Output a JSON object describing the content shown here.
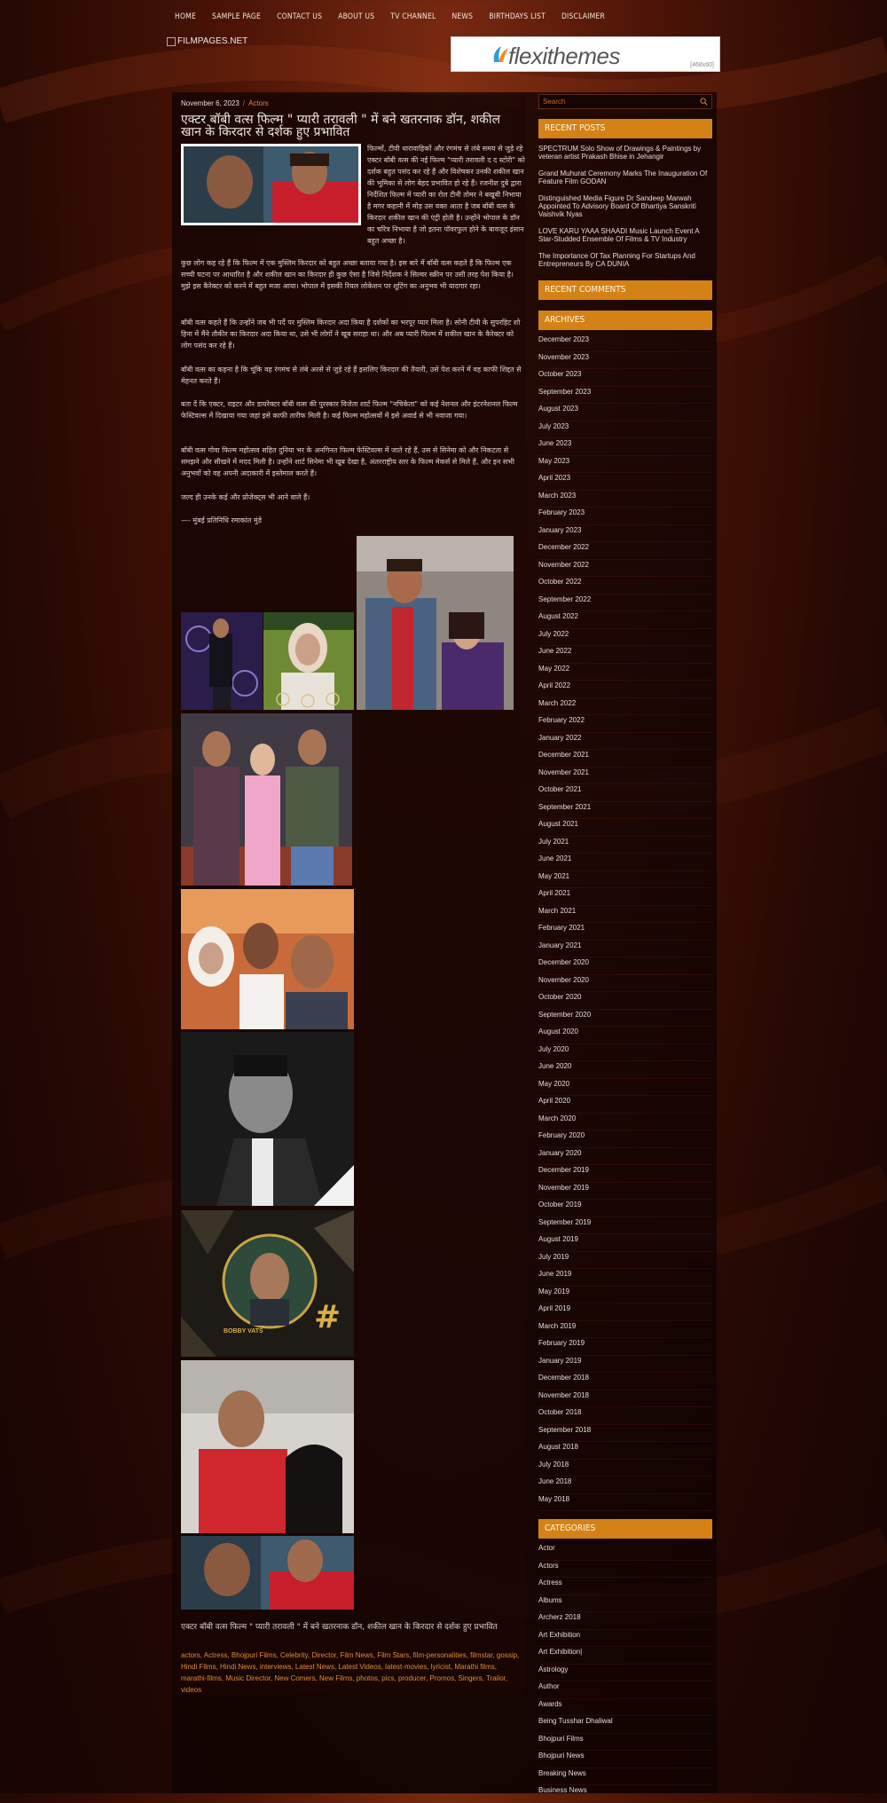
{
  "nav": [
    "HOME",
    "SAMPLE PAGE",
    "CONTACT US",
    "ABOUT US",
    "TV CHANNEL",
    "NEWS",
    "BIRTHDAYS LIST",
    "DISCLAIMER"
  ],
  "logo_text": "FILMPAGES.NET",
  "ad": {
    "brand": "flexithemes",
    "size": "[468x60]"
  },
  "post": {
    "date": "November 6, 2023",
    "category": "Actors",
    "title": "एक्टर बॉबी वत्स फिल्म \" प्यारी तरावली \" में बने खतरनाक डॉन, शकील खान के किरदार से दर्शक हुए प्रभावित",
    "para1": "फिल्मों, टीवी धारावाहिकों और रंगमंच से लंबे समय से जुड़े रहे एक्टर बॉबी वत्स की नई फिल्म \"प्यारी तरावली द द स्टोरी\" को दर्शक बहुत पसंद कर रहे हैं और विशेषकर उनकी शकील खान की भूमिका से लोग बेहद प्रभावित हो रहे हैं। रजनीश दुबे द्वारा निर्देशित फिल्म में प्यारी का रोल टीनी तोमर ने बखूबी निभाया है मगर कहानी में मोड़ उस वक्त आता है जब बॉबी वत्स के किरदार शकील खान की एंट्री होती है। उन्होंने भोपाल के डॉन का चरित्र निभाया है जो इतना पॉवरफुल होने के बावजूद इंसान बहुत अच्छा है।",
    "para2": "कुछ लोग कह रहे हैं कि फिल्म में एक मुस्लिम किरदार को बहुत अच्छा बताया गया है। इस बारे में बॉबी वत्स कहते हैं कि फिल्म एक सच्ची घटना पर आधारित है और शकील खान का किरदार ही कुछ ऐसा है जिसे निर्देशक ने सिल्वर स्क्रीन पर उसी तरह पेश किया है। मुझे इस कैरेक्टर को करने में बहुत मजा आया। भोपाल में इसकी रियल लोकेशन पर शूटिंग का अनुभव भी यादगार रहा।",
    "para3": "बॉबी वत्स कहते हैं कि उन्होंने जब भी पर्दे पर मुस्लिम किरदार अदा किया है दर्शकों का भरपूर प्यार मिला है। सोनी टीवी के सुपरहिट शो हिना में मैंने तौकीर का किरदार अदा किया था, उसे भी लोगों ने खूब सराहा था। और अब प्यारी फिल्म में शकील खान के कैरेक्टर को लोग पसंद कर रहे हैं।",
    "para4": "बॉबी वत्स का कहना है कि चूंकि वह रंगमंच से लंबे अरसे से जुड़े रहे हैं इसलिए किरदार की तैयारी, उसे पेश करने में वह काफी शिद्दत से मेहनत करते हैं।",
    "para5": "बता दें कि एक्टर, राइटर और डायरेक्टर बॉबी वत्स की पुरस्कार विजेता शार्ट फिल्म \"नचिकेता\" को कई नेशनल और इंटरनेशनल फिल्म फेस्टिवल्स में दिखाया गया जहां इसे काफी तारीफ मिली है। कई फिल्म महोत्सवों में इसे अवार्ड से भी नवाजा गया।",
    "para6": "बॉबी वत्स गोवा फिल्म महोत्सव सहित दुनिया भर के अनगिनत फिल्म फेस्टिवल्स में जाते रहे हैं, उस से सिनेमा को और निकटता से समझने और सीखने में मदद मिली है। उन्होंने शार्ट सिनेमा भी खूब देखा है, अंतरराष्ट्रीय स्तर के फिल्म मेकर्स से मिले हैं, और इन सभी अनुभवों को वह अपनी अदाकारी में इस्तेमाल करते हैं।",
    "para7": "जल्द ही उनके कई और प्रोजेक्ट्स भी आने वाले हैं।",
    "byline": "—- मुंबई प्रतिनिधि रमाकांत मुंडे",
    "gallery_caption": "BOBBY VATS",
    "footer_title": "एक्टर बॉबी वत्स फिल्म \" प्यारी तरावली \" में बने खतरनाक डॉन, शकील खान के किरदार से दर्शक हुए प्रभावित",
    "tags": "actors, Actress, Bhojpuri Films, Celebrity, Director, Film News, Film Stars, film-personalities, filmstar, gossip, Hindi Films, Hindi News, interviews, Latest News, Latest Videos, latest-movies, lyricist, Marathi films, marathi-films, Music Director, New Comers, New Films, photos, pics, producer, Promos, Singers, Trailor, videos"
  },
  "sidebar": {
    "search_placeholder": "Search",
    "recent_posts_title": "RECENT POSTS",
    "recent_posts": [
      "SPECTRUM Solo Show of Drawings & Paintings by veteran artist Prakash Bhise in Jehangir",
      "Grand Muhurat Ceremony Marks The Inauguration Of Feature Film GODAN",
      "Distinguished Media Figure Dr Sandeep Marwah Appointed To Advisory Board Of Bhartiya Sanskriti Vaishvik Nyas",
      "LOVE KARU YAAA SHAADI Music Launch Event A Star-Studded Ensemble Of Films & TV Industry",
      "The Importance Of Tax Planning For Startups And Entrepreneurs By CA DUNIA"
    ],
    "recent_comments_title": "RECENT COMMENTS",
    "archives_title": "ARCHIVES",
    "archives": [
      "December 2023",
      "November 2023",
      "October 2023",
      "September 2023",
      "August 2023",
      "July 2023",
      "June 2023",
      "May 2023",
      "April 2023",
      "March 2023",
      "February 2023",
      "January 2023",
      "December 2022",
      "November 2022",
      "October 2022",
      "September 2022",
      "August 2022",
      "July 2022",
      "June 2022",
      "May 2022",
      "April 2022",
      "March 2022",
      "February 2022",
      "January 2022",
      "December 2021",
      "November 2021",
      "October 2021",
      "September 2021",
      "August 2021",
      "July 2021",
      "June 2021",
      "May 2021",
      "April 2021",
      "March 2021",
      "February 2021",
      "January 2021",
      "December 2020",
      "November 2020",
      "October 2020",
      "September 2020",
      "August 2020",
      "July 2020",
      "June 2020",
      "May 2020",
      "April 2020",
      "March 2020",
      "February 2020",
      "January 2020",
      "December 2019",
      "November 2019",
      "October 2019",
      "September 2019",
      "August 2019",
      "July 2019",
      "June 2019",
      "May 2019",
      "April 2019",
      "March 2019",
      "February 2019",
      "January 2019",
      "December 2018",
      "November 2018",
      "October 2018",
      "September 2018",
      "August 2018",
      "July 2018",
      "June 2018",
      "May 2018"
    ],
    "categories_title": "CATEGORIES",
    "categories": [
      "Actor",
      "Actors",
      "Actress",
      "Albums",
      "Archerz 2018",
      "Art Exhibition",
      "Art Exhibition|",
      "Astrology",
      "Author",
      "Awards",
      "Being Tusshar Dhaliwal",
      "Bhojpuri Films",
      "Bhojpuri News",
      "Breaking News",
      "Business News"
    ]
  },
  "colors": {
    "accent": "#d48215",
    "link": "#e08b3a",
    "bg_dark": "#1a0503"
  }
}
